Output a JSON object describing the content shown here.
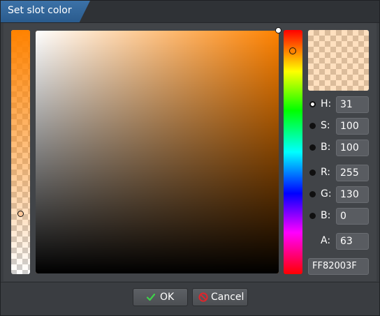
{
  "dialog": {
    "title": "Set slot color"
  },
  "color": {
    "hex": "FF82003F",
    "alpha_fraction": 0.25,
    "hue_deg": 31,
    "preview_rgba": "rgba(255,130,0,0.25)",
    "base_hex": "#ff8200"
  },
  "fields": {
    "h": {
      "label": "H:",
      "value": "31"
    },
    "s": {
      "label": "S:",
      "value": "100"
    },
    "b_hsb": {
      "label": "B:",
      "value": "100"
    },
    "r": {
      "label": "R:",
      "value": "255"
    },
    "g": {
      "label": "G:",
      "value": "130"
    },
    "b_rgb": {
      "label": "B:",
      "value": "0"
    },
    "a": {
      "label": "A:",
      "value": "63"
    }
  },
  "selected_mode": "H",
  "buttons": {
    "ok_label": "OK",
    "cancel_label": "Cancel"
  },
  "icons": {
    "ok": "checkmark-icon",
    "cancel": "cancel-circle-icon"
  }
}
